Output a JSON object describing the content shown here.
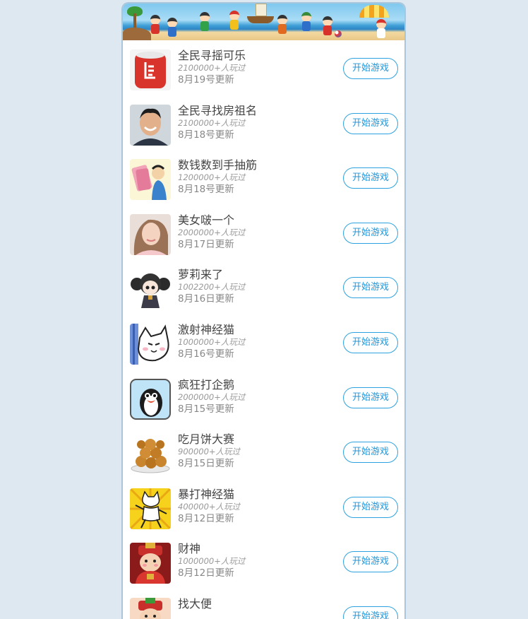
{
  "banner": {
    "icon": "beach-pirates-banner"
  },
  "colors": {
    "button_border": "#2ea2e0",
    "button_text": "#2496d8",
    "page_background": "#dde8f1",
    "name_text": "#444444",
    "meta_text": "#999999"
  },
  "games": [
    {
      "name": "全民寻摇可乐",
      "plays": "2100000+人玩过",
      "updated": "8月19号更新",
      "button": "开始游戏",
      "icon": "red-cola-can-icon"
    },
    {
      "name": "全民寻找房祖名",
      "plays": "2100000+人玩过",
      "updated": "8月18号更新",
      "button": "开始游戏",
      "icon": "smiling-man-portrait-icon"
    },
    {
      "name": "数钱数到手抽筋",
      "plays": "1200000+人玩过",
      "updated": "8月18号更新",
      "button": "开始游戏",
      "icon": "counting-money-cartoon-icon"
    },
    {
      "name": "美女啵一个",
      "plays": "2000000+人玩过",
      "updated": "8月17日更新",
      "button": "开始游戏",
      "icon": "girl-portrait-icon"
    },
    {
      "name": "萝莉来了",
      "plays": "1002200+人玩过",
      "updated": "8月16日更新",
      "button": "开始游戏",
      "icon": "chibi-girl-icon"
    },
    {
      "name": "激射神经猫",
      "plays": "1000000+人玩过",
      "updated": "8月16号更新",
      "button": "开始游戏",
      "icon": "white-cat-icon"
    },
    {
      "name": "疯狂打企鹅",
      "plays": "2000000+人玩过",
      "updated": "8月15号更新",
      "button": "开始游戏",
      "icon": "penguin-icon"
    },
    {
      "name": "吃月饼大赛",
      "plays": "900000+人玩过",
      "updated": "8月15日更新",
      "button": "开始游戏",
      "icon": "mooncake-plate-icon"
    },
    {
      "name": "暴打神经猫",
      "plays": "400000+人玩过",
      "updated": "8月12日更新",
      "button": "开始游戏",
      "icon": "dancing-cat-icon"
    },
    {
      "name": "财神",
      "plays": "1000000+人玩过",
      "updated": "8月12日更新",
      "button": "开始游戏",
      "icon": "god-of-wealth-icon"
    },
    {
      "name": "找大便",
      "plays": "",
      "updated": "",
      "button": "开始游戏",
      "icon": "god-of-wealth-partial-icon"
    }
  ]
}
